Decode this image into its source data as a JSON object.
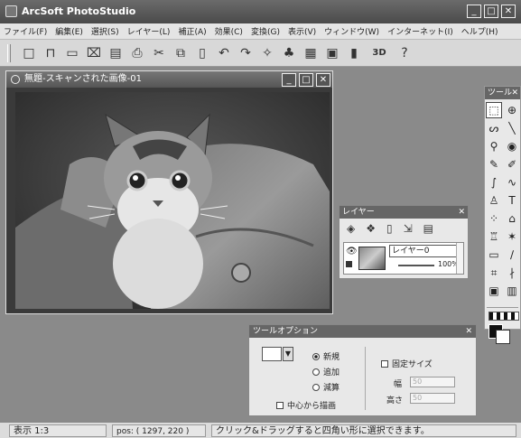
{
  "app": {
    "title": "ArcSoft PhotoStudio"
  },
  "window_controls": [
    "_",
    "□",
    "✕"
  ],
  "menu": [
    "ファイル(F)",
    "編集(E)",
    "選択(S)",
    "レイヤー(L)",
    "補正(A)",
    "効果(C)",
    "変換(G)",
    "表示(V)",
    "ウィンドウ(W)",
    "インターネット(I)",
    "ヘルプ(H)"
  ],
  "toolbar": {
    "icons": [
      "new-file-icon",
      "open-file-icon",
      "acquire-icon",
      "scan-icon",
      "save-icon",
      "print-icon",
      "cut-icon",
      "copy-icon",
      "paste-icon",
      "undo-icon",
      "redo-icon",
      "magic-icon",
      "auto-enhance-icon",
      "calendar-icon",
      "album-icon",
      "film-icon",
      "3d-icon",
      "help-icon"
    ],
    "glyphs": [
      "□",
      "⊓",
      "▭",
      "⌧",
      "▤",
      "⎙",
      "✂",
      "⧉",
      "▯",
      "↶",
      "↷",
      "✧",
      "♣",
      "▦",
      "▣",
      "▮",
      "3D",
      "?"
    ]
  },
  "image_window": {
    "title": "無題-スキャンされた画像-01"
  },
  "tool_palette": {
    "title": "ツール",
    "close": "✕",
    "tools": [
      {
        "name": "rect-select-icon",
        "glyph": "⬚"
      },
      {
        "name": "move-icon",
        "glyph": "⊕"
      },
      {
        "name": "lasso-icon",
        "glyph": "ᔕ"
      },
      {
        "name": "line-icon",
        "glyph": "╲"
      },
      {
        "name": "zoom-icon",
        "glyph": "⚲"
      },
      {
        "name": "eye-icon",
        "glyph": "◉"
      },
      {
        "name": "pencil-icon",
        "glyph": "✎"
      },
      {
        "name": "brush-icon",
        "glyph": "✐"
      },
      {
        "name": "airbrush-icon",
        "glyph": "∫"
      },
      {
        "name": "smudge-icon",
        "glyph": "∿"
      },
      {
        "name": "stamp-icon",
        "glyph": "♙"
      },
      {
        "name": "text-icon",
        "glyph": "T"
      },
      {
        "name": "magic-wand-icon",
        "glyph": "⁘"
      },
      {
        "name": "bucket-icon",
        "glyph": "⌂"
      },
      {
        "name": "clone-icon",
        "glyph": "♖"
      },
      {
        "name": "sparkle-icon",
        "glyph": "✶"
      },
      {
        "name": "eraser-icon",
        "glyph": "▭"
      },
      {
        "name": "pen-icon",
        "glyph": "∕"
      },
      {
        "name": "crop-icon",
        "glyph": "⌗"
      },
      {
        "name": "eyedropper-icon",
        "glyph": "∤"
      },
      {
        "name": "shape-icon",
        "glyph": "▣"
      },
      {
        "name": "trash-icon",
        "glyph": "▥"
      }
    ]
  },
  "layer_palette": {
    "title": "レイヤー",
    "close": "✕",
    "icons": [
      "layer-new-icon",
      "layer-duplicate-icon",
      "layer-delete-icon",
      "layer-merge-icon",
      "layer-flatten-icon"
    ],
    "icon_glyphs": [
      "◈",
      "❖",
      "▯",
      "⇲",
      "▤"
    ],
    "layer_name": "レイヤー0",
    "opacity": "100%"
  },
  "option_palette": {
    "title": "ツールオプション",
    "close": "✕",
    "modes": [
      "新規",
      "追加",
      "減算"
    ],
    "selected_mode": "新規",
    "center_draw": "中心から描画",
    "fixed_size": "固定サイズ",
    "width_label": "幅",
    "width_value": "50",
    "height_label": "高さ",
    "height_value": "50"
  },
  "status": {
    "zoom": "表示 1:3",
    "pos": "pos: ( 1297, 220 )",
    "message": "クリック&ドラッグすると四角い形に選択できます。"
  }
}
